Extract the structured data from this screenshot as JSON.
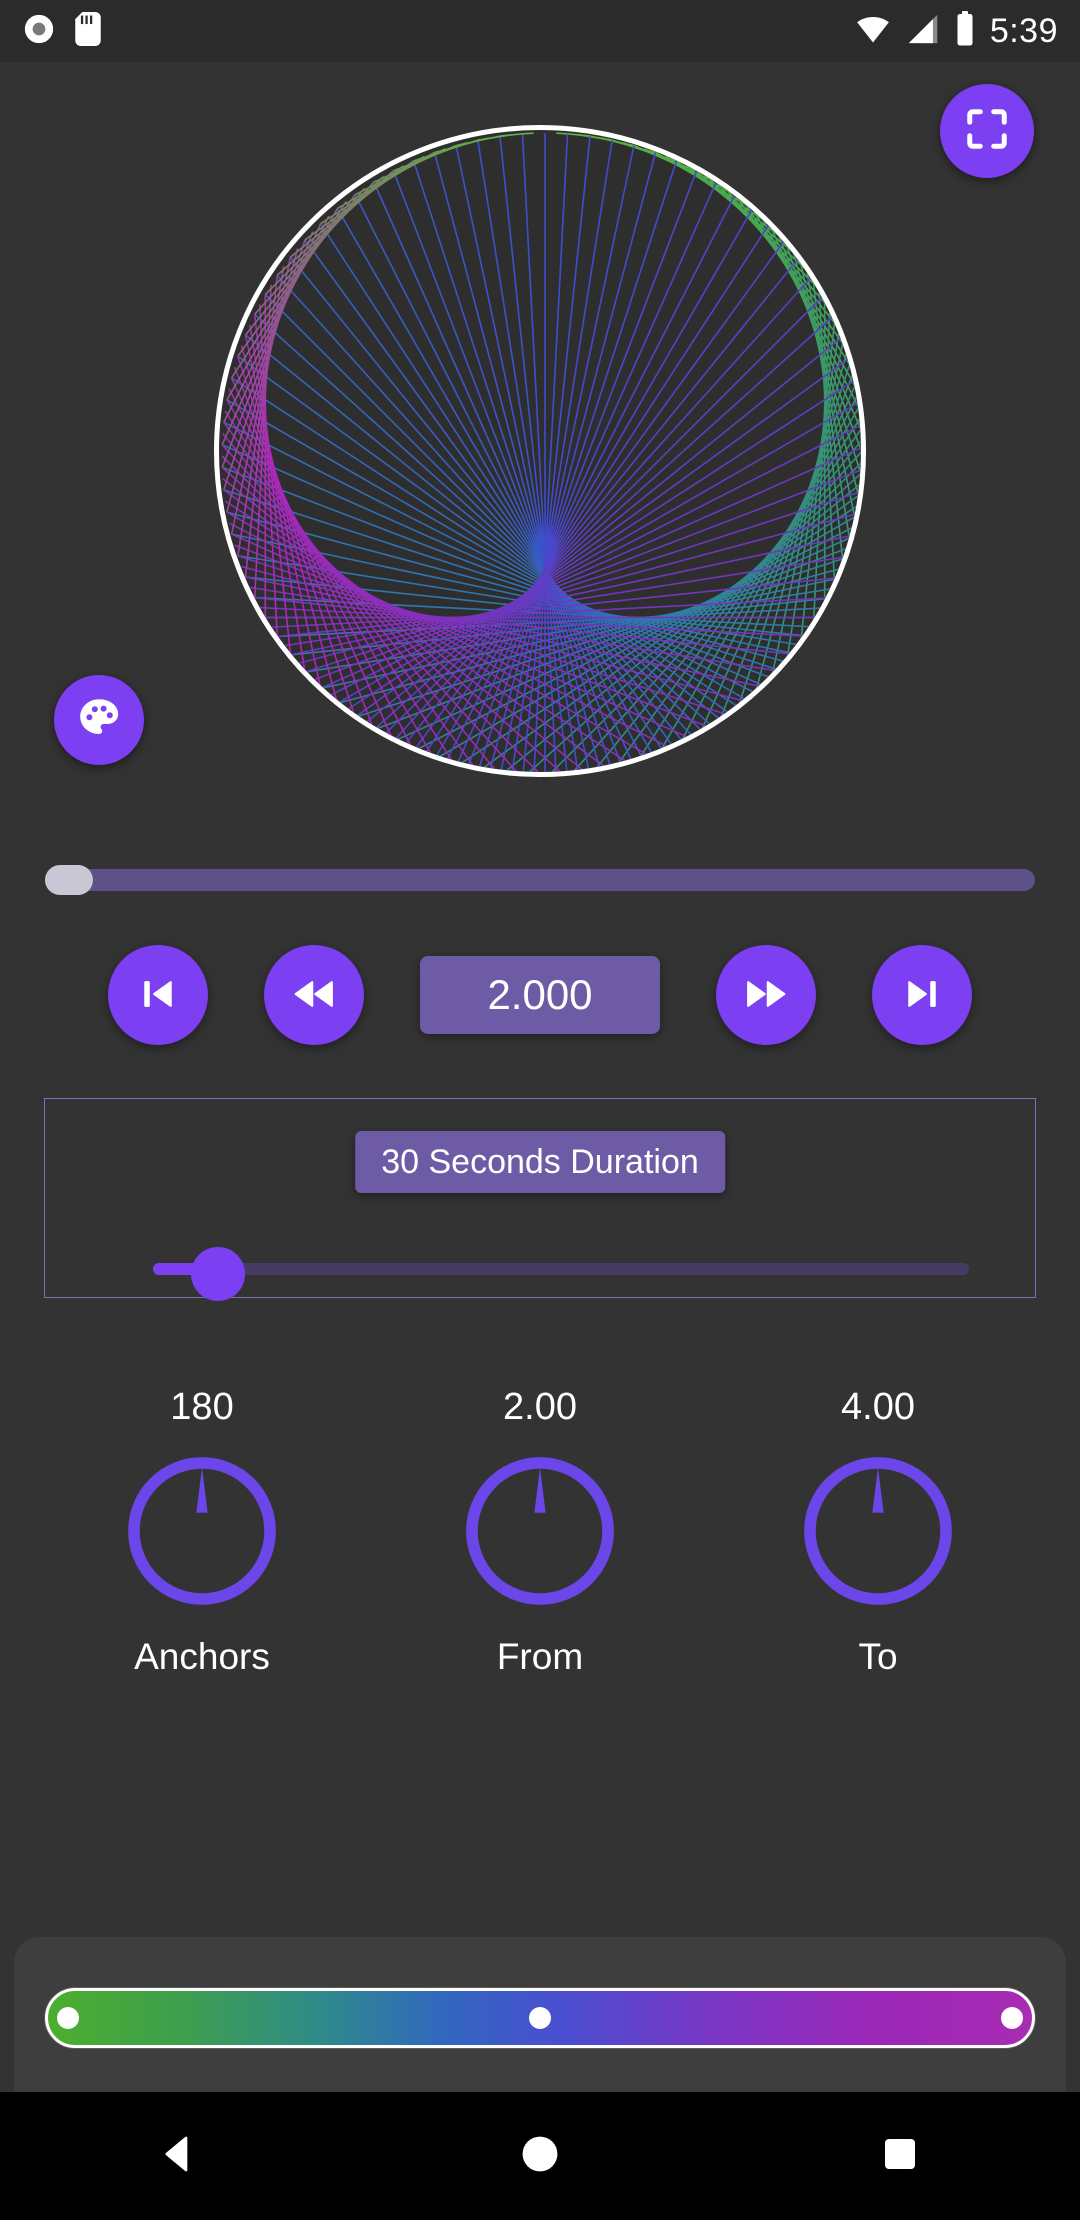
{
  "statusbar": {
    "icons": [
      "record-icon",
      "sd-card-icon",
      "wifi-icon",
      "cell-signal-icon",
      "battery-icon"
    ],
    "time": "5:39"
  },
  "canvas": {
    "fullscreen_button": {
      "icon": "fullscreen-icon",
      "label": "Fullscreen"
    },
    "palette_button": {
      "icon": "palette-icon",
      "label": "Colors"
    },
    "artwork": {
      "type": "string-art-circle",
      "outline_color": "#ffffff",
      "anchors": 180,
      "multiplier_from": 2.0,
      "multiplier_to": 4.0,
      "current_multiplier": 2.0
    }
  },
  "progress": {
    "value_percent": 0,
    "track_color": "#5E5187",
    "thumb_color": "#c9c6d6"
  },
  "transport": {
    "skip_previous": {
      "icon": "skip-previous-icon",
      "label": "Skip to start"
    },
    "rewind": {
      "icon": "rewind-icon",
      "label": "Rewind"
    },
    "speed_value": "2.000",
    "fast_forward": {
      "icon": "fast-forward-icon",
      "label": "Fast forward"
    },
    "skip_next": {
      "icon": "skip-next-icon",
      "label": "Skip to end"
    },
    "accent_color": "#7C3FF2",
    "value_box_color": "#6E5BA6"
  },
  "duration": {
    "button_label": "30 Seconds Duration",
    "slider_percent": 5,
    "accent_color": "#7C3FF2",
    "border_color": "#7e6fb5"
  },
  "knobs": [
    {
      "value": "180",
      "label": "Anchors",
      "angle_deg": 0,
      "color": "#6B46E8"
    },
    {
      "value": "2.00",
      "label": "From",
      "angle_deg": 0,
      "color": "#6B46E8"
    },
    {
      "value": "4.00",
      "label": "To",
      "angle_deg": 0,
      "color": "#6B46E8"
    }
  ],
  "gradient_picker": {
    "stops": [
      "#4CAF2E",
      "#2F8C87",
      "#3168BE",
      "#7A35C4",
      "#A82CB4"
    ],
    "handle_positions_percent": [
      2,
      50,
      98
    ],
    "border_color": "#ffffff"
  },
  "navbar": {
    "back": {
      "icon": "back-triangle-icon",
      "label": "Back"
    },
    "home": {
      "icon": "home-circle-icon",
      "label": "Home"
    },
    "recents": {
      "icon": "recents-square-icon",
      "label": "Recents"
    }
  }
}
